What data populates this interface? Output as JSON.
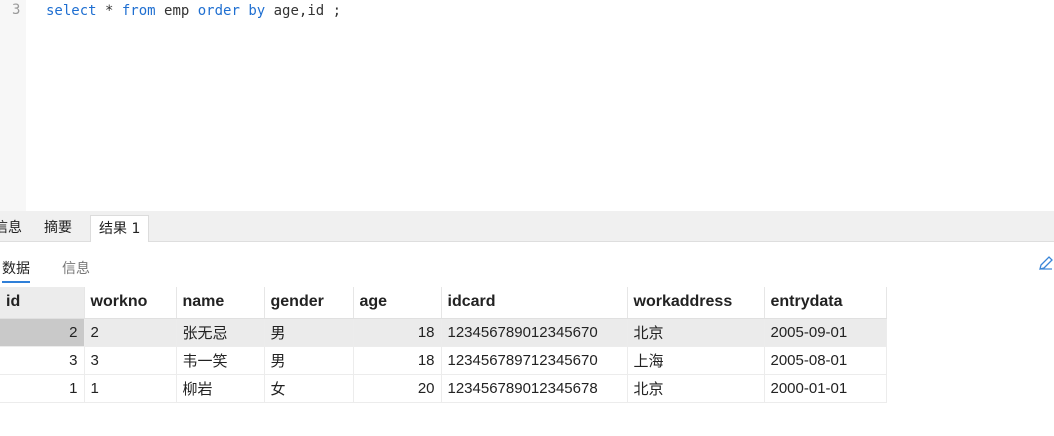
{
  "editor": {
    "line_number": "3",
    "code_tokens": [
      {
        "text": "select",
        "kw": true
      },
      {
        "text": " * ",
        "kw": false
      },
      {
        "text": "from",
        "kw": true
      },
      {
        "text": " emp ",
        "kw": false
      },
      {
        "text": "order",
        "kw": true
      },
      {
        "text": " ",
        "kw": false
      },
      {
        "text": "by",
        "kw": true
      },
      {
        "text": " age,id ;",
        "kw": false
      }
    ]
  },
  "tabs": [
    {
      "label": "信息",
      "active": false
    },
    {
      "label": "摘要",
      "active": false
    },
    {
      "label": "结果 1",
      "active": true
    }
  ],
  "subtabs": [
    {
      "label": "数据",
      "active": true
    },
    {
      "label": "信息",
      "active": false
    }
  ],
  "grid": {
    "columns": [
      "id",
      "workno",
      "name",
      "gender",
      "age",
      "idcard",
      "workaddress",
      "entrydata"
    ],
    "rows": [
      [
        "2",
        "2",
        "张无忌",
        "男",
        "18",
        "123456789012345670",
        "北京",
        "2005-09-01"
      ],
      [
        "3",
        "3",
        "韦一笑",
        "男",
        "18",
        "123456789712345670",
        "上海",
        "2005-08-01"
      ],
      [
        "1",
        "1",
        "柳岩",
        "女",
        "20",
        "123456789012345678",
        "北京",
        "2000-01-01"
      ]
    ],
    "selected_row": 0
  },
  "icons": {
    "edit": "pencil-icon"
  },
  "colors": {
    "keyword": "#1f6fd1",
    "active_underline": "#2f7fd8"
  }
}
